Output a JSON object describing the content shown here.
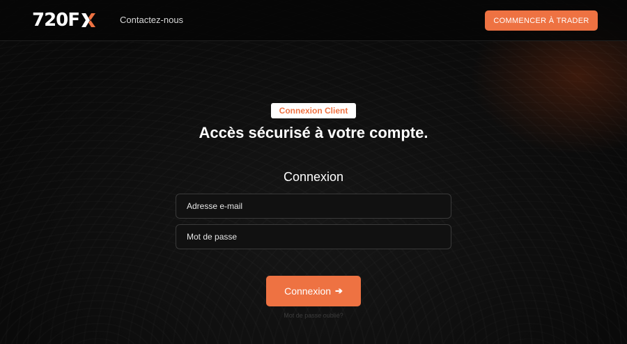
{
  "header": {
    "logo_text": "720F",
    "logo_mark_icon": "x-chevron-logo-icon",
    "nav_contact": "Contactez-nous",
    "cta_label": "COMMENCER À TRADER"
  },
  "hero": {
    "badge": "Connexion Client",
    "headline": "Accès sécurisé à votre compte."
  },
  "login_form": {
    "title": "Connexion",
    "email_placeholder": "Adresse e-mail",
    "password_placeholder": "Mot de passe",
    "submit_label": "Connexion",
    "submit_icon": "arrow-right-icon",
    "forgot_password": "Mot de passe oublié?"
  },
  "colors": {
    "accent": "#ee7242",
    "background": "#0c0c0c",
    "text": "#ffffff"
  }
}
